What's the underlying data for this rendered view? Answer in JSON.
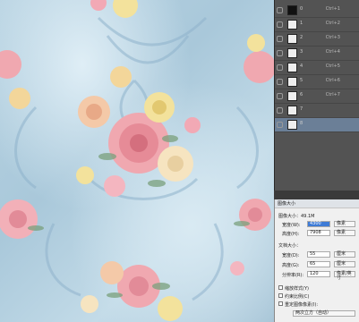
{
  "layers": [
    {
      "name": "0",
      "shortcut": "Ctrl+1",
      "thumb": "#111111"
    },
    {
      "name": "1",
      "shortcut": "Ctrl+2",
      "thumb": "#eeeeee"
    },
    {
      "name": "2",
      "shortcut": "Ctrl+3",
      "thumb": "#eeeeee"
    },
    {
      "name": "3",
      "shortcut": "Ctrl+4",
      "thumb": "#eeeeee"
    },
    {
      "name": "4",
      "shortcut": "Ctrl+5",
      "thumb": "#eeeeee"
    },
    {
      "name": "5",
      "shortcut": "Ctrl+6",
      "thumb": "#eeeeee"
    },
    {
      "name": "6",
      "shortcut": "Ctrl+7",
      "thumb": "#eeeeee"
    },
    {
      "name": "7",
      "shortcut": "",
      "thumb": "#eeeeee"
    },
    {
      "name": "8",
      "shortcut": "",
      "thumb": "#eeeeee"
    }
  ],
  "dialog": {
    "title": "图像大小",
    "image_size": "图像大小：49.1M",
    "width_label": "宽度(W):",
    "width_value": "4300",
    "height_label": "高度(H):",
    "height_value": "7908",
    "unit_pixels": "像素",
    "doc_size": "文档大小：",
    "doc_width_label": "宽度(D):",
    "doc_width_value": "55",
    "doc_height_label": "高度(G):",
    "doc_height_value": "65",
    "resolution_label": "分辨率(R):",
    "resolution_value": "120",
    "unit_cm": "厘米",
    "unit_ppi": "像素/英寸",
    "scale_styles": "缩放样式(Y)",
    "constrain": "约束比例(C)",
    "resample": "重定图像像素(I):",
    "method": "两次立方（自动）"
  }
}
